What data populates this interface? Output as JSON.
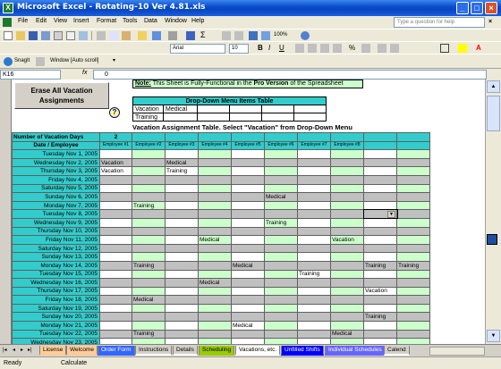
{
  "window": {
    "title": "Microsoft Excel - Rotating-10 Ver 4.81.xls",
    "app_icon": "X"
  },
  "menu": [
    "File",
    "Edit",
    "View",
    "Insert",
    "Format",
    "Tools",
    "Data",
    "Window",
    "Help"
  ],
  "help_placeholder": "Type a question for help",
  "toolbar": {
    "zoom": "100%",
    "font_name": "Arial",
    "font_size": "10",
    "snagit": "SnagIt",
    "window_label": "Window [Auto scroll]"
  },
  "formula": {
    "name_box": "K16",
    "fx": "fx",
    "value": "0"
  },
  "sheet": {
    "erase_button": "Erase All Vacation Assignments",
    "note_label": "Note:",
    "note_text": " This Sheet is Fully-Functional in the ",
    "note_bold": "Pro Version",
    "note_tail": " of the Spreadsheet",
    "help_icon": "?",
    "dropdown_title": "Drop-Down Menu Items Table",
    "dropdown_items": [
      "Vacation",
      "Medical",
      "Training"
    ],
    "assignment_title": "Vacation Assignment Table. Select \"Vacation\" from Drop-Down Menu",
    "vacation_days_label": "Number of Vacation Days",
    "vacation_days_value": "2",
    "date_header": "Date / Employee",
    "employees": [
      "Employee #1",
      "Employee #2",
      "Employee #3",
      "Employee #4",
      "Employee #5",
      "Employee #6",
      "Employee #7",
      "Employee #8",
      "",
      ""
    ],
    "rows": [
      {
        "date": "Tuesday Nov 1, 2005",
        "cells": [
          "",
          "",
          "",
          "",
          "",
          "",
          "",
          "",
          "",
          ""
        ]
      },
      {
        "date": "Wednesday Nov 2, 2005",
        "cells": [
          "Vacation",
          "",
          "Medical",
          "",
          "",
          "",
          "",
          "",
          "",
          ""
        ]
      },
      {
        "date": "Thursday Nov 3, 2005",
        "cells": [
          "Vacation",
          "",
          "Training",
          "",
          "",
          "",
          "",
          "",
          "",
          ""
        ]
      },
      {
        "date": "Friday Nov 4, 2005",
        "cells": [
          "",
          "",
          "",
          "",
          "",
          "",
          "",
          "",
          "",
          ""
        ]
      },
      {
        "date": "Saturday Nov 5, 2005",
        "cells": [
          "",
          "",
          "",
          "",
          "",
          "",
          "",
          "",
          "",
          ""
        ]
      },
      {
        "date": "Sunday Nov 6, 2005",
        "cells": [
          "",
          "",
          "",
          "",
          "",
          "Medical",
          "",
          "",
          "",
          ""
        ]
      },
      {
        "date": "Monday Nov 7, 2005",
        "cells": [
          "",
          "Training",
          "",
          "",
          "",
          "",
          "",
          "",
          "",
          ""
        ]
      },
      {
        "date": "Tuesday Nov 8, 2005",
        "cells": [
          "",
          "",
          "",
          "",
          "",
          "",
          "",
          "",
          "",
          ""
        ]
      },
      {
        "date": "Wednesday Nov 9, 2005",
        "cells": [
          "",
          "",
          "",
          "",
          "",
          "Training",
          "",
          "",
          "",
          ""
        ]
      },
      {
        "date": "Thursday Nov 10, 2005",
        "cells": [
          "",
          "",
          "",
          "",
          "",
          "",
          "",
          "",
          "",
          ""
        ]
      },
      {
        "date": "Friday Nov 11, 2005",
        "cells": [
          "",
          "",
          "",
          "Medical",
          "",
          "",
          "",
          "Vacation",
          "",
          ""
        ]
      },
      {
        "date": "Saturday Nov 12, 2005",
        "cells": [
          "",
          "",
          "",
          "",
          "",
          "",
          "",
          "",
          "",
          ""
        ]
      },
      {
        "date": "Sunday Nov 13, 2005",
        "cells": [
          "",
          "",
          "",
          "",
          "",
          "",
          "",
          "",
          "",
          ""
        ]
      },
      {
        "date": "Monday Nov 14, 2005",
        "cells": [
          "",
          "Training",
          "",
          "",
          "Medical",
          "",
          "",
          "",
          "Training",
          "Training"
        ]
      },
      {
        "date": "Tuesday Nov 15, 2005",
        "cells": [
          "",
          "",
          "",
          "",
          "",
          "",
          "Training",
          "",
          "",
          ""
        ]
      },
      {
        "date": "Wednesday Nov 16, 2005",
        "cells": [
          "",
          "",
          "",
          "Medical",
          "",
          "",
          "",
          "",
          "",
          ""
        ]
      },
      {
        "date": "Thursday Nov 17, 2005",
        "cells": [
          "",
          "",
          "",
          "",
          "",
          "",
          "",
          "",
          "Vacation",
          ""
        ]
      },
      {
        "date": "Friday Nov 18, 2005",
        "cells": [
          "",
          "Medical",
          "",
          "",
          "",
          "",
          "",
          "",
          "",
          ""
        ]
      },
      {
        "date": "Saturday Nov 19, 2005",
        "cells": [
          "",
          "",
          "",
          "",
          "",
          "",
          "",
          "",
          "",
          ""
        ]
      },
      {
        "date": "Sunday Nov 20, 2005",
        "cells": [
          "",
          "",
          "",
          "",
          "",
          "",
          "",
          "",
          "Training",
          ""
        ]
      },
      {
        "date": "Monday Nov 21, 2005",
        "cells": [
          "",
          "",
          "",
          "",
          "Medical",
          "",
          "",
          "",
          "",
          ""
        ]
      },
      {
        "date": "Tuesday Nov 22, 2005",
        "cells": [
          "",
          "Training",
          "",
          "",
          "",
          "",
          "",
          "Medical",
          "",
          ""
        ]
      },
      {
        "date": "Wednesday Nov 23, 2005",
        "cells": [
          "",
          "",
          "",
          "",
          "",
          "",
          "",
          "",
          "",
          ""
        ]
      }
    ]
  },
  "tabs": [
    {
      "label": "License",
      "color": "#ffcc99"
    },
    {
      "label": "Welcome",
      "color": "#ffcc99"
    },
    {
      "label": "Order Form",
      "color": "#3366ff"
    },
    {
      "label": "Instructions",
      "color": "#ffffff"
    },
    {
      "label": "Details",
      "color": "#ffffff"
    },
    {
      "label": "Scheduling",
      "color": "#99cc00"
    },
    {
      "label": "Vacations, etc.",
      "color": "#ffffff",
      "active": true
    },
    {
      "label": "Unfilled Shifts",
      "color": "#0000ff"
    },
    {
      "label": "Individual Schedules",
      "color": "#6666ff"
    },
    {
      "label": "Calend",
      "color": "#ffffff"
    }
  ],
  "status": {
    "left": "Ready",
    "mode": "Calculate"
  }
}
